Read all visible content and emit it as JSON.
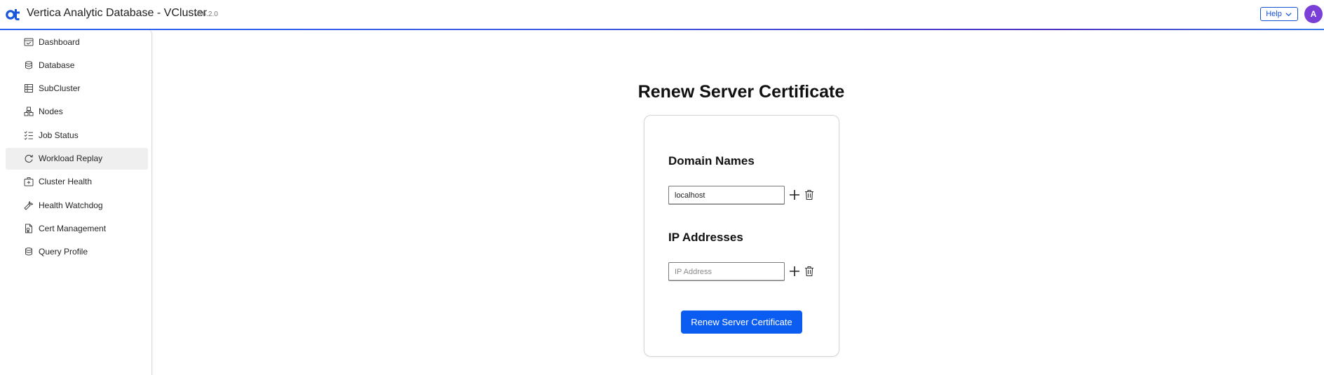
{
  "header": {
    "title": "Vertica Analytic Database - VCluster",
    "version": "v26.2.0",
    "help_label": "Help",
    "avatar_initial": "A",
    "logo_icon": "vertica-ot-logo",
    "accent_color": "#2a64f0"
  },
  "sidebar": {
    "active_item": "Workload Replay",
    "items": [
      {
        "label": "Dashboard",
        "icon": "dashboard-icon"
      },
      {
        "label": "Database",
        "icon": "database-icon"
      },
      {
        "label": "SubCluster",
        "icon": "subcluster-icon"
      },
      {
        "label": "Nodes",
        "icon": "nodes-icon"
      },
      {
        "label": "Job Status",
        "icon": "job-status-icon"
      },
      {
        "label": "Workload Replay",
        "icon": "replay-icon"
      },
      {
        "label": "Cluster Health",
        "icon": "cluster-health-icon"
      },
      {
        "label": "Health Watchdog",
        "icon": "wrench-icon"
      },
      {
        "label": "Cert Management",
        "icon": "certificate-icon"
      },
      {
        "label": "Query Profile",
        "icon": "query-profile-icon"
      }
    ]
  },
  "main": {
    "title": "Renew Server Certificate",
    "domain_section": {
      "title": "Domain Names",
      "value": "localhost",
      "placeholder": ""
    },
    "ip_section": {
      "title": "IP Addresses",
      "value": "",
      "placeholder": "IP Address"
    },
    "submit_label": "Renew Server Certificate",
    "button_color": "#0b5cf0"
  }
}
